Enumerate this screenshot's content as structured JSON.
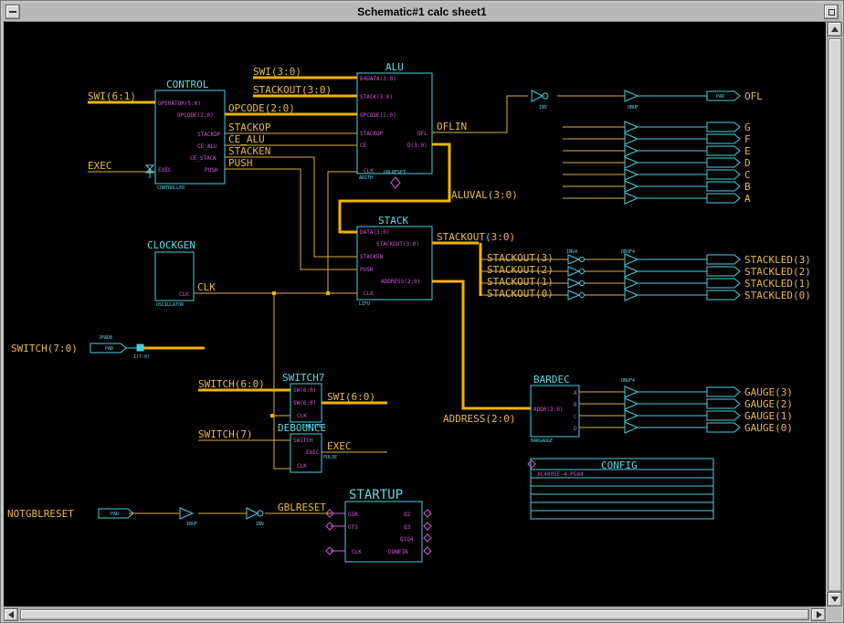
{
  "window": {
    "title": "Schematic#1 calc sheet1"
  },
  "blocks": {
    "control": {
      "name": "CONTROL",
      "type": "CONTROLLER",
      "pins": [
        "OPERATOR(5:0)",
        "OPCODE(2:0)",
        "STACKOP",
        "CE_ALU",
        "CE_STACK",
        "PUSH",
        "EXEC"
      ]
    },
    "alu": {
      "name": "ALU",
      "type": "ARITH",
      "gbl": "GBLRESET",
      "pins": [
        "B4DATA(3:0)",
        "STACK(3:0)",
        "OPCODE(2:0)",
        "STACKOP",
        "CE",
        "CLK",
        "OFL",
        "D(3:0)"
      ]
    },
    "stack": {
      "name": "STACK",
      "type": "LIFO",
      "pins": [
        "DATA(3:0)",
        "STACKOUT(3:0)",
        "STACKEN",
        "PUSH",
        "ADDRESS(2:0)",
        "CLK"
      ]
    },
    "clockgen": {
      "name": "CLOCKGEN",
      "type": "OSCILLATOR",
      "pin": "CLK"
    },
    "switch7": {
      "name": "SWITCH7",
      "type": "SWITCHES",
      "pins": [
        "SW(6:0)",
        "SW(6:0)",
        "CLK"
      ]
    },
    "debounce": {
      "name": "DEBOUNCE",
      "type": "PULSE",
      "pins": [
        "SWITCH",
        "EXEC",
        "CLK"
      ]
    },
    "bardec": {
      "name": "BARDEC",
      "type": "BARGAUGE",
      "pins": [
        "ADDR(2:0)",
        "A",
        "B",
        "C",
        "D"
      ]
    },
    "config": {
      "name": "CONFIG",
      "text": "XC4005E-4-PG84"
    },
    "startup": {
      "name": "STARTUP",
      "pins_left": [
        "GSR",
        "GTS",
        "CLK"
      ],
      "pins_right": [
        "Q2",
        "Q3",
        "Q1Q4",
        "DONEIN"
      ]
    },
    "jpad": {
      "name": "JPAD8",
      "bus": "I(7:0)"
    }
  },
  "nets": {
    "sw61": "SWI(6:1)",
    "exec_in": "EXEC",
    "swi30": "SWI(3:0)",
    "stackout30_top": "STACKOUT(3:0)",
    "opcode": "OPCODE(2:0)",
    "stackop": "STACKOP",
    "ce_alu": "CE_ALU",
    "stacken": "STACKEN",
    "push": "PUSH",
    "oflin": "OFLIN",
    "aluval": "ALUVAL(3:0)",
    "stackout_mid": "STACKOUT(3:0)",
    "clk": "CLK",
    "stackout_bits": [
      "STACKOUT(3)",
      "STACKOUT(2)",
      "STACKOUT(1)",
      "STACKOUT(0)"
    ],
    "switch70": "SWITCH(7:0)",
    "switch60": "SWITCH(6:0)",
    "swi60": "SWI(6:0)",
    "switch7": "SWITCH(7)",
    "exec_out": "EXEC",
    "address": "ADDRESS(2:0)",
    "notgblreset": "NOTGBLRESET",
    "gblreset": "GBLRESET"
  },
  "outputs": {
    "ofl": "OFL",
    "segments": [
      "G",
      "F",
      "E",
      "D",
      "C",
      "B",
      "A"
    ],
    "stackled": [
      "STACKLED(3)",
      "STACKLED(2)",
      "STACKLED(1)",
      "STACKLED(0)"
    ],
    "gauge": [
      "GAUGE(3)",
      "GAUGE(2)",
      "GAUGE(1)",
      "GAUGE(0)"
    ]
  },
  "prims": {
    "inv": "INV",
    "obuf": "OBUF",
    "inv4": "INV4",
    "obuf4": "OBUF4",
    "ibuf": "IBUF",
    "pad": "PAD"
  },
  "colors": {
    "canvas": "#000000",
    "wire": "#d8b044",
    "bus": "#f0b400",
    "symbol": "#48d0e0",
    "pin": "#d15bd6"
  }
}
